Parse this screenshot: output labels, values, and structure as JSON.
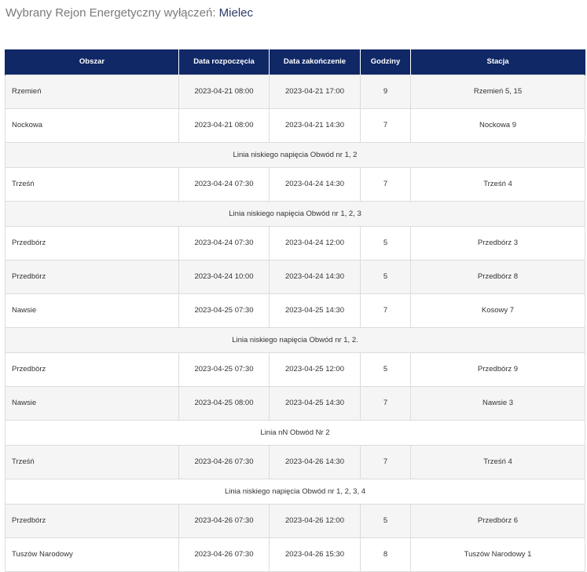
{
  "header": {
    "prefix": "Wybrany Rejon Energetyczny wyłączeń:",
    "region": "Mielec"
  },
  "table": {
    "columns": [
      "Obszar",
      "Data rozpoczęcia",
      "Data zakończenie",
      "Godziny",
      "Stacja"
    ],
    "rows": [
      {
        "type": "data",
        "area": "Rzemień",
        "start": "2023-04-21 08:00",
        "end": "2023-04-21 17:00",
        "hours": "9",
        "station": "Rzemień 5, 15"
      },
      {
        "type": "data",
        "area": "Nockowa",
        "start": "2023-04-21 08:00",
        "end": "2023-04-21 14:30",
        "hours": "7",
        "station": "Nockowa 9"
      },
      {
        "type": "note",
        "text": "Linia niskiego napięcia Obwód nr 1, 2"
      },
      {
        "type": "data",
        "area": "Trześń",
        "start": "2023-04-24 07:30",
        "end": "2023-04-24 14:30",
        "hours": "7",
        "station": "Trześń 4"
      },
      {
        "type": "note",
        "text": "Linia niskiego napięcia Obwód nr 1, 2, 3"
      },
      {
        "type": "data",
        "area": "Przedbórz",
        "start": "2023-04-24 07:30",
        "end": "2023-04-24 12:00",
        "hours": "5",
        "station": "Przedbórz 3"
      },
      {
        "type": "data",
        "area": "Przedbórz",
        "start": "2023-04-24 10:00",
        "end": "2023-04-24 14:30",
        "hours": "5",
        "station": "Przedbórz 8"
      },
      {
        "type": "data",
        "area": "Nawsie",
        "start": "2023-04-25 07:30",
        "end": "2023-04-25 14:30",
        "hours": "7",
        "station": "Kosowy 7"
      },
      {
        "type": "note",
        "text": "Linia niskiego napięcia Obwód nr 1, 2."
      },
      {
        "type": "data",
        "area": "Przedbórz",
        "start": "2023-04-25 07:30",
        "end": "2023-04-25 12:00",
        "hours": "5",
        "station": "Przedbórz 9"
      },
      {
        "type": "data",
        "area": "Nawsie",
        "start": "2023-04-25 08:00",
        "end": "2023-04-25 14:30",
        "hours": "7",
        "station": "Nawsie 3"
      },
      {
        "type": "note",
        "text": "Linia nN Obwód Nr 2"
      },
      {
        "type": "data",
        "area": "Trześń",
        "start": "2023-04-26 07:30",
        "end": "2023-04-26 14:30",
        "hours": "7",
        "station": "Trześń 4"
      },
      {
        "type": "note",
        "text": "Linia niskiego napięcia Obwód nr 1, 2, 3, 4"
      },
      {
        "type": "data",
        "area": "Przedbórz",
        "start": "2023-04-26 07:30",
        "end": "2023-04-26 12:00",
        "hours": "5",
        "station": "Przedbórz 6"
      },
      {
        "type": "data",
        "area": "Tuszów Narodowy",
        "start": "2023-04-26 07:30",
        "end": "2023-04-26 15:30",
        "hours": "8",
        "station": "Tuszów Narodowy 1"
      }
    ]
  }
}
